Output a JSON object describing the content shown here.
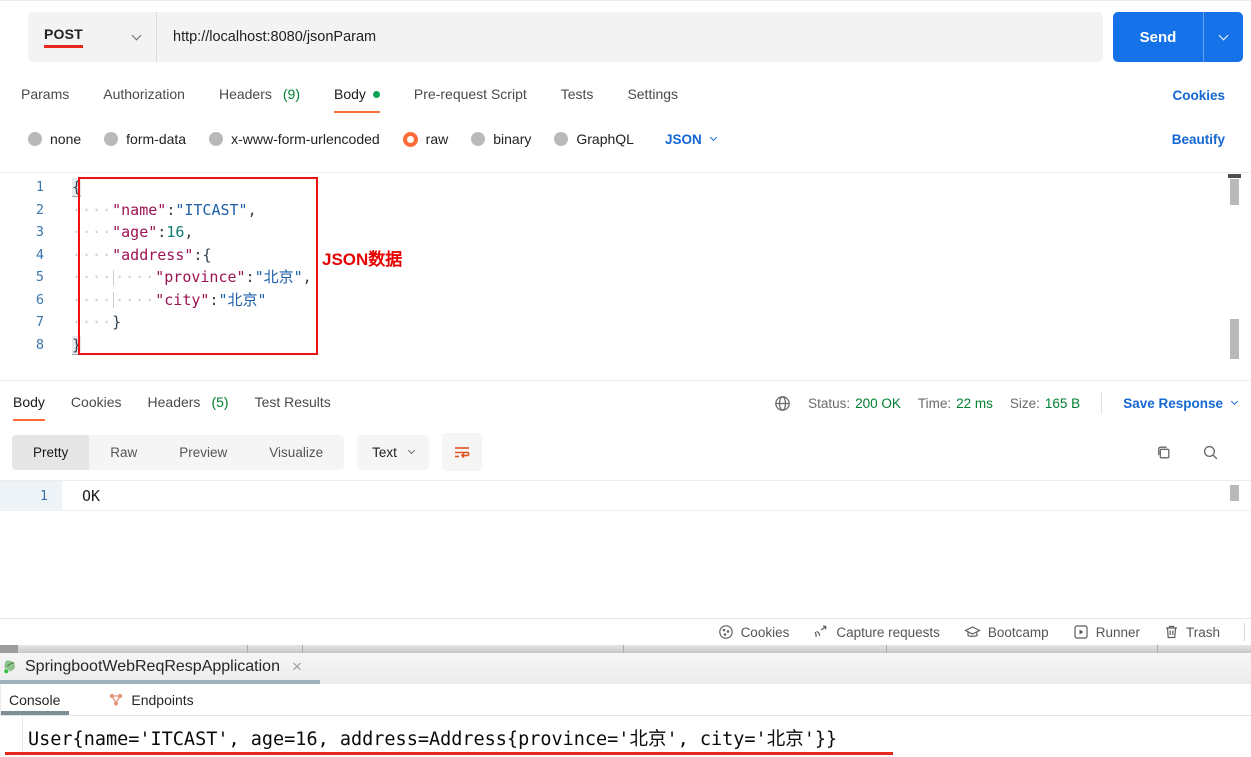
{
  "colors": {
    "accent_orange": "#ff6c37",
    "link_blue": "#1567d3",
    "send_blue": "#1672e8",
    "success_green": "#007f31",
    "annotation_red": "#e8281e"
  },
  "request": {
    "method": "POST",
    "url": "http://localhost:8080/jsonParam",
    "send_label": "Send",
    "tabs": [
      {
        "label": "Params"
      },
      {
        "label": "Authorization"
      },
      {
        "label": "Headers",
        "badge": "(9)"
      },
      {
        "label": "Body"
      },
      {
        "label": "Pre-request Script"
      },
      {
        "label": "Tests"
      },
      {
        "label": "Settings"
      }
    ],
    "cookies_link": "Cookies",
    "body_modes": [
      {
        "label": "none"
      },
      {
        "label": "form-data"
      },
      {
        "label": "x-www-form-urlencoded"
      },
      {
        "label": "raw"
      },
      {
        "label": "binary"
      },
      {
        "label": "GraphQL"
      }
    ],
    "format_select": "JSON",
    "beautify_link": "Beautify"
  },
  "editor": {
    "annotation": "JSON数据",
    "lines": [
      {
        "num": "1",
        "open": "{"
      },
      {
        "num": "2",
        "ws": "····",
        "key": "\"name\"",
        "colon": ":",
        "val": "\"ITCAST\"",
        "comma": ","
      },
      {
        "num": "3",
        "ws": "····",
        "key": "\"age\"",
        "colon": ":",
        "val": "16",
        "comma": ","
      },
      {
        "num": "4",
        "ws": "····",
        "key": "\"address\"",
        "colon": ":",
        "open": "{"
      },
      {
        "num": "5",
        "ws1": "····",
        "ws2": "····",
        "key": "\"province\"",
        "colon": ":",
        "val": "\"北京\"",
        "comma": ","
      },
      {
        "num": "6",
        "ws1": "····",
        "ws2": "····",
        "key": "\"city\"",
        "colon": ":",
        "val": "\"北京\""
      },
      {
        "num": "7",
        "ws": "····",
        "close": "}"
      },
      {
        "num": "8",
        "close": "}"
      }
    ]
  },
  "response": {
    "tabs": [
      {
        "label": "Body"
      },
      {
        "label": "Cookies"
      },
      {
        "label": "Headers",
        "badge": "(5)"
      },
      {
        "label": "Test Results"
      }
    ],
    "status_label": "Status:",
    "status_value": "200 OK",
    "time_label": "Time:",
    "time_value": "22 ms",
    "size_label": "Size:",
    "size_value": "165 B",
    "save_label": "Save Response",
    "views": [
      {
        "label": "Pretty"
      },
      {
        "label": "Raw"
      },
      {
        "label": "Preview"
      },
      {
        "label": "Visualize"
      }
    ],
    "format_select": "Text",
    "body": {
      "line_num": "1",
      "text": "OK"
    }
  },
  "footer": {
    "items": [
      {
        "label": "Cookies"
      },
      {
        "label": "Capture requests"
      },
      {
        "label": "Bootcamp"
      },
      {
        "label": "Runner"
      },
      {
        "label": "Trash"
      }
    ]
  },
  "ide": {
    "run_tab_title": "SpringbootWebReqRespApplication",
    "close_glyph": "×",
    "tabs": [
      {
        "label": "Console"
      },
      {
        "label": "Endpoints"
      }
    ],
    "console_output": "User{name='ITCAST', age=16, address=Address{province='北京', city='北京'}}"
  }
}
